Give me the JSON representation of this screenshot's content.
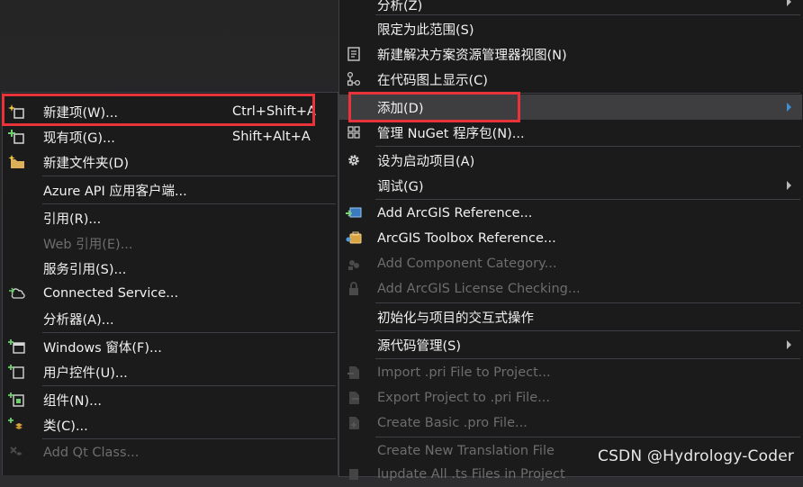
{
  "left_menu": {
    "items": [
      {
        "label": "新建项(W)...",
        "shortcut": "Ctrl+Shift+A",
        "icon": "new-item-icon"
      },
      {
        "label": "现有项(G)...",
        "shortcut": "Shift+Alt+A",
        "icon": "existing-item-icon"
      },
      {
        "label": "新建文件夹(D)",
        "icon": "new-folder-icon"
      },
      {
        "label": "Azure API 应用客户端..."
      },
      {
        "label": "引用(R)..."
      },
      {
        "label": "Web 引用(E)...",
        "disabled": true
      },
      {
        "label": "服务引用(S)..."
      },
      {
        "label": "Connected Service...",
        "icon": "connected-service-icon"
      },
      {
        "label": "分析器(A)..."
      },
      {
        "label": "Windows 窗体(F)...",
        "icon": "windows-form-icon"
      },
      {
        "label": "用户控件(U)...",
        "icon": "user-control-icon"
      },
      {
        "label": "组件(N)...",
        "icon": "component-icon"
      },
      {
        "label": "类(C)...",
        "icon": "class-icon"
      },
      {
        "label": "Add Qt Class...",
        "disabled": true,
        "icon": "qt-class-icon"
      }
    ]
  },
  "right_menu": {
    "items": [
      {
        "label": "分析(Z)",
        "submenu": true
      },
      {
        "label": "限定为此范围(S)"
      },
      {
        "label": "新建解决方案资源管理器视图(N)",
        "icon": "new-explorer-view-icon"
      },
      {
        "label": "在代码图上显示(C)",
        "icon": "code-map-icon"
      },
      {
        "label": "添加(D)",
        "submenu": true,
        "highlighted": true
      },
      {
        "label": "管理 NuGet 程序包(N)...",
        "icon": "nuget-package-icon"
      },
      {
        "label": "设为启动项目(A)",
        "icon": "gear-icon"
      },
      {
        "label": "调试(G)",
        "submenu": true
      },
      {
        "label": "Add ArcGIS Reference...",
        "icon": "arcgis-reference-icon"
      },
      {
        "label": "ArcGIS Toolbox Reference...",
        "icon": "arcgis-toolbox-icon"
      },
      {
        "label": "Add Component Category...",
        "disabled": true,
        "icon": "component-category-icon"
      },
      {
        "label": "Add ArcGIS License Checking...",
        "disabled": true,
        "icon": "license-checking-icon"
      },
      {
        "label": "初始化与项目的交互式操作"
      },
      {
        "label": "源代码管理(S)",
        "submenu": true
      },
      {
        "label": "Import .pri File to Project...",
        "disabled": true,
        "icon": "import-pri-icon"
      },
      {
        "label": "Export Project to .pri File...",
        "disabled": true,
        "icon": "export-pri-icon"
      },
      {
        "label": "Create Basic .pro File...",
        "disabled": true,
        "icon": "create-pro-icon"
      },
      {
        "label": "Create New Translation File",
        "disabled": true
      },
      {
        "label": "lupdate All .ts Files in Project",
        "disabled": true,
        "icon": "lupdate-icon"
      }
    ]
  },
  "watermark": "CSDN @Hydrology-Coder",
  "colors": {
    "menu_bg": "#1b1b1c",
    "highlight_bg": "#3e3e40",
    "annotation_red": "#e8333a",
    "text": "#f1f1f1",
    "disabled_text": "#6d6d6d"
  }
}
